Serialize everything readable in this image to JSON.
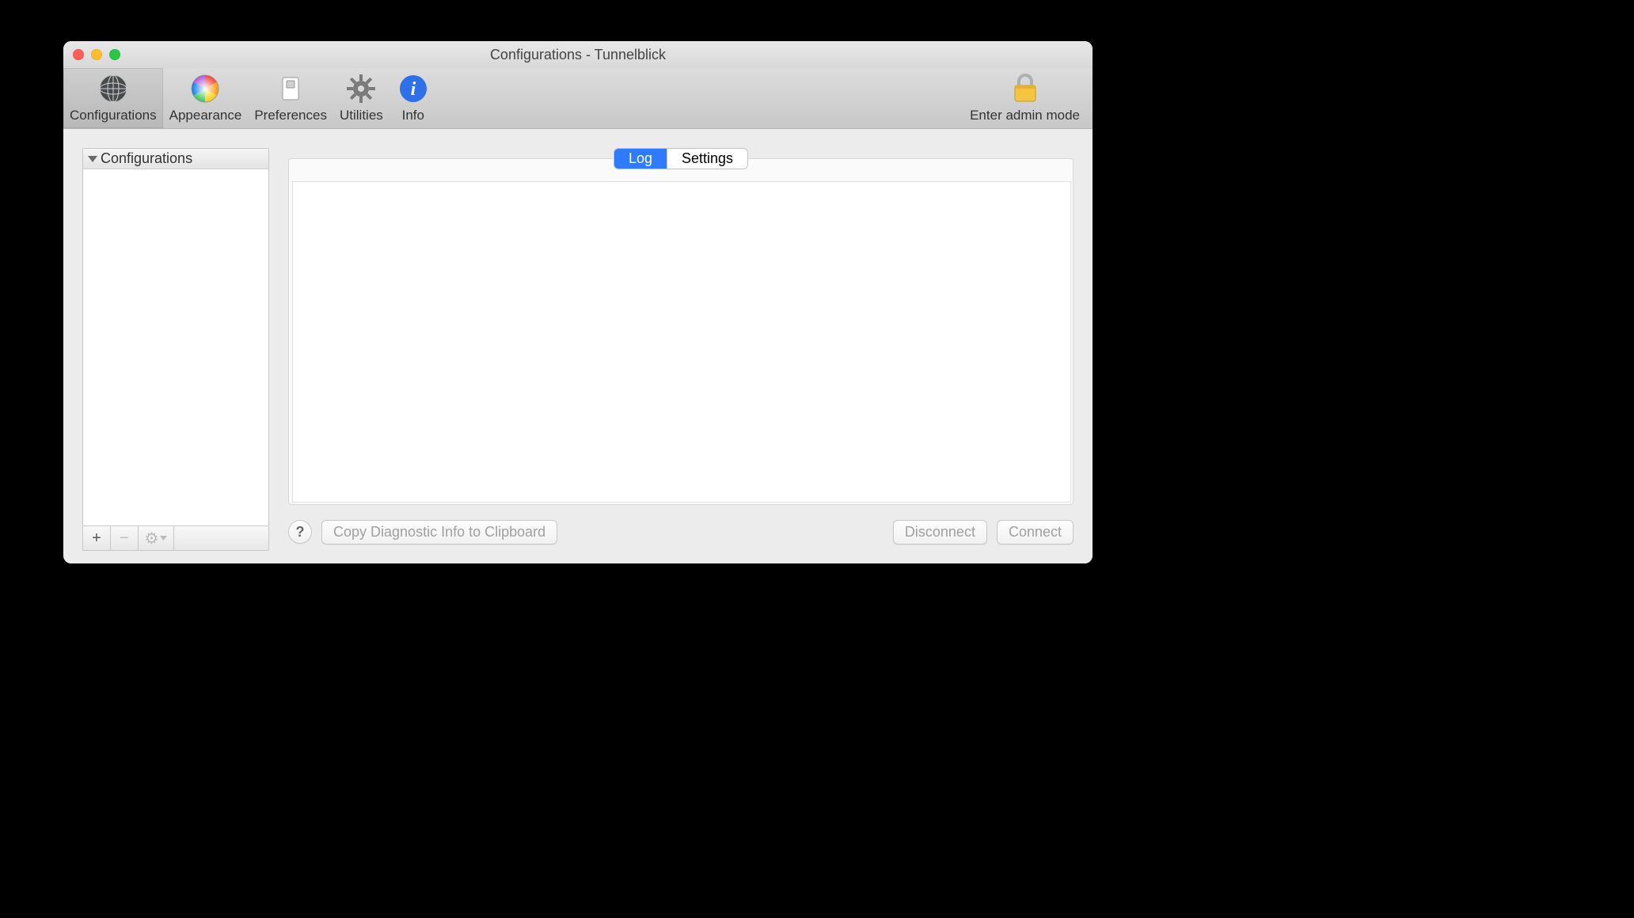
{
  "window": {
    "title": "Configurations - Tunnelblick"
  },
  "toolbar": {
    "items": [
      {
        "label": "Configurations",
        "active": true
      },
      {
        "label": "Appearance",
        "active": false
      },
      {
        "label": "Preferences",
        "active": false
      },
      {
        "label": "Utilities",
        "active": false
      },
      {
        "label": "Info",
        "active": false
      }
    ],
    "admin_label": "Enter admin mode"
  },
  "sidebar": {
    "header": "Configurations",
    "items": [],
    "tools": {
      "add": "+",
      "remove": "−",
      "action": "⚙︎"
    }
  },
  "main": {
    "tabs": [
      {
        "label": "Log",
        "active": true
      },
      {
        "label": "Settings",
        "active": false
      }
    ],
    "log_text": ""
  },
  "footer": {
    "help": "?",
    "copy_diag": "Copy Diagnostic Info to Clipboard",
    "disconnect": "Disconnect",
    "connect": "Connect"
  }
}
